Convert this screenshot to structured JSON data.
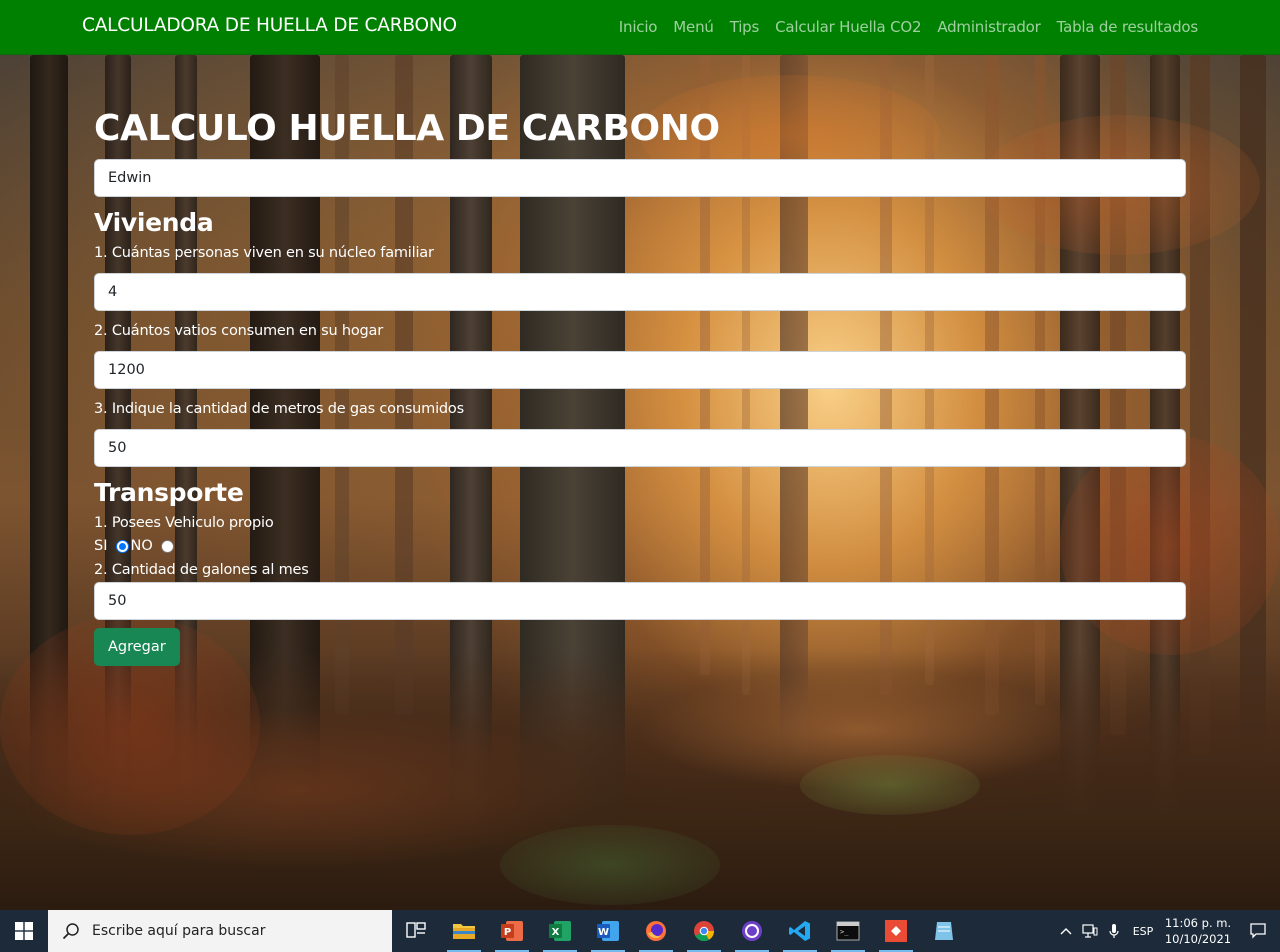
{
  "navbar": {
    "brand": "CALCULADORA DE HUELLA DE CARBONO",
    "links": [
      "Inicio",
      "Menú",
      "Tips",
      "Calcular Huella CO2",
      "Administrador",
      "Tabla de resultados"
    ]
  },
  "form": {
    "title": "CALCULO HUELLA DE CARBONO",
    "name_value": "Edwin",
    "vivienda": {
      "heading": "Vivienda",
      "q1_label": "1. Cuántas personas viven en su núcleo familiar",
      "q1_value": "4",
      "q2_label": "2. Cuántos vatios consumen en su hogar",
      "q2_value": "1200",
      "q3_label": "3. Indique la cantidad de metros de gas consumidos",
      "q3_value": "50"
    },
    "transporte": {
      "heading": "Transporte",
      "q1_label": "1. Posees Vehiculo propio",
      "option_si": "SI",
      "option_no": "NO",
      "selected": "SI",
      "q2_label": "2. Cantidad de galones al mes",
      "q2_value": "50"
    },
    "submit_label": "Agregar"
  },
  "taskbar": {
    "search_placeholder": "Escribe aquí para buscar",
    "apps": [
      "task-view",
      "file-explorer",
      "powerpoint",
      "excel",
      "word",
      "firefox",
      "chrome",
      "github-desktop",
      "vscode",
      "terminal",
      "git-app",
      "notepad"
    ],
    "language": "ESP",
    "time": "11:06 p. m.",
    "date": "10/10/2021"
  },
  "colors": {
    "navbar": "#008000",
    "button": "#198754",
    "taskbar": "#1c2a3a",
    "radio_checked": "#0075ff"
  }
}
